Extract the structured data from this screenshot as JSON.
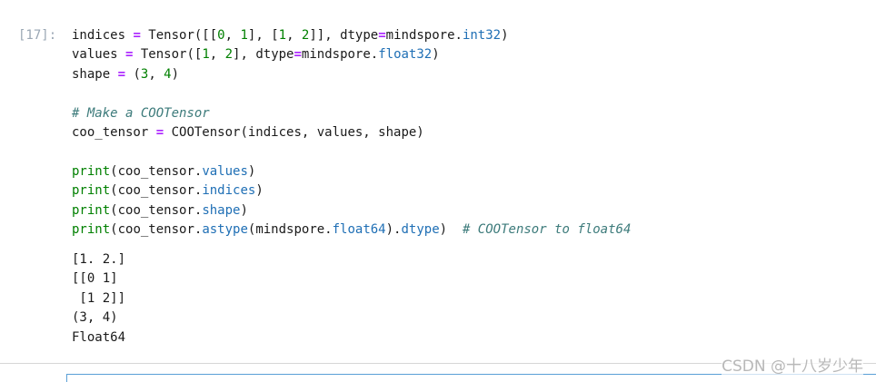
{
  "cell": {
    "prompt": "[17]:",
    "code": {
      "l1": {
        "a": "indices ",
        "b": "=",
        "c": " Tensor([[",
        "d": "0",
        "e": ", ",
        "f": "1",
        "g": "], [",
        "h": "1",
        "i": ", ",
        "j": "2",
        "k": "]], dtype",
        "l": "=",
        "m": "mindspore.",
        "n": "int32",
        "o": ")"
      },
      "l2": {
        "a": "values ",
        "b": "=",
        "c": " Tensor([",
        "d": "1",
        "e": ", ",
        "f": "2",
        "g": "], dtype",
        "h": "=",
        "i": "mindspore.",
        "j": "float32",
        "k": ")"
      },
      "l3": {
        "a": "shape ",
        "b": "=",
        "c": " (",
        "d": "3",
        "e": ", ",
        "f": "4",
        "g": ")"
      },
      "l5": {
        "a": "# Make a COOTensor"
      },
      "l6": {
        "a": "coo_tensor ",
        "b": "=",
        "c": " COOTensor(indices, values, shape)"
      },
      "l8": {
        "a": "print",
        "b": "(coo_tensor.",
        "c": "values",
        "d": ")"
      },
      "l9": {
        "a": "print",
        "b": "(coo_tensor.",
        "c": "indices",
        "d": ")"
      },
      "l10": {
        "a": "print",
        "b": "(coo_tensor.",
        "c": "shape",
        "d": ")"
      },
      "l11": {
        "a": "print",
        "b": "(coo_tensor.",
        "c": "astype",
        "d": "(mindspore.",
        "e": "float64",
        "f": ").",
        "g": "dtype",
        "h": ")  ",
        "i": "# COOTensor to float64"
      }
    },
    "output": [
      "[1. 2.]",
      "[[0 1]",
      " [1 2]]",
      "(3, 4)",
      "Float64"
    ]
  },
  "watermark": "CSDN @十八岁少年"
}
